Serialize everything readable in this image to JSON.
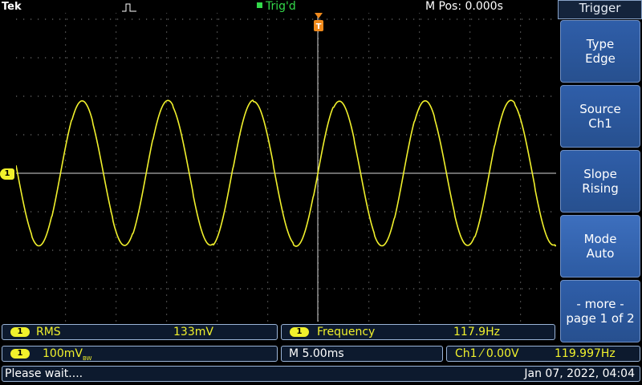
{
  "header": {
    "brand": "Tek",
    "trigger_status": "Trig'd",
    "horizontal_position": "M Pos: 0.000s"
  },
  "channel_marker": "1",
  "side_menu": {
    "title": "Trigger",
    "buttons": [
      {
        "line1": "Type",
        "line2": "Edge"
      },
      {
        "line1": "Source",
        "line2": "Ch1"
      },
      {
        "line1": "Slope",
        "line2": "Rising"
      },
      {
        "line1": "Mode",
        "line2": "Auto"
      },
      {
        "line1": "- more -",
        "line2": "page 1 of 2"
      }
    ]
  },
  "measurements": [
    {
      "channel": "1",
      "name": "RMS",
      "value": "133mV"
    },
    {
      "channel": "1",
      "name": "Frequency",
      "value": "117.9Hz"
    }
  ],
  "settings_bar": {
    "channel": "1",
    "vertical_scale": "100mV",
    "bandwidth_marker": "BW",
    "timebase": "M 5.00ms",
    "trigger_source": "Ch1",
    "trigger_slope_symbol": "⁄",
    "trigger_level": "0.00V",
    "trigger_frequency": "119.997Hz"
  },
  "status_bar": {
    "message": "Please wait....",
    "datetime": "Jan 07, 2022, 04:04"
  },
  "colors": {
    "channel1": "#f1f12c",
    "trigger_marker": "#f08a1c",
    "triggered_text": "#33d94a",
    "menu_button": "#2f5ea9"
  },
  "waveform": {
    "channel": "1",
    "shape": "sine",
    "frequency_hz": 117.9,
    "rms_mv": 133,
    "volts_per_div_mv": 100,
    "time_per_div_ms": 5.0
  }
}
